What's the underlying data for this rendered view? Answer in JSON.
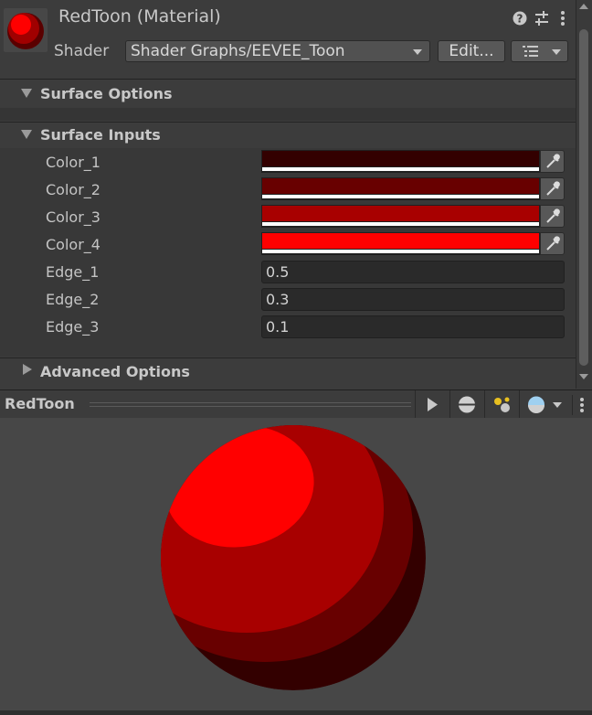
{
  "header": {
    "title": "RedToon (Material)",
    "shader_label": "Shader",
    "shader_value": "Shader Graphs/EEVEE_Toon",
    "edit_label": "Edit...",
    "icons": [
      "help-icon",
      "preset-sliders-icon",
      "kebab-menu-icon"
    ]
  },
  "sections": {
    "surface_options": "Surface Options",
    "surface_inputs": "Surface Inputs",
    "advanced_options": "Advanced Options"
  },
  "properties": {
    "colors": [
      {
        "label": "Color_1",
        "value": "#330000"
      },
      {
        "label": "Color_2",
        "value": "#680000"
      },
      {
        "label": "Color_3",
        "value": "#a80000"
      },
      {
        "label": "Color_4",
        "value": "#ff0000"
      }
    ],
    "edges": [
      {
        "label": "Edge_1",
        "value": "0.5"
      },
      {
        "label": "Edge_2",
        "value": "0.3"
      },
      {
        "label": "Edge_3",
        "value": "0.1"
      }
    ]
  },
  "preview": {
    "title": "RedToon",
    "buttons": [
      "play-icon",
      "sphere-mesh-icon",
      "lighting-icon",
      "environment-sphere-icon"
    ]
  },
  "colors": {
    "panel_bg": "#3c3c3c",
    "field_bg": "#2a2a2a",
    "preview_bg": "#474747",
    "toon_band_1": "#330000",
    "toon_band_2": "#680000",
    "toon_band_3": "#a80000",
    "toon_band_4": "#ff0000"
  }
}
